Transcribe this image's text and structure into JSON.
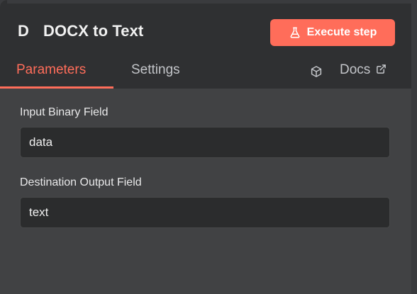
{
  "node": {
    "icon_letter": "D",
    "title": "DOCX to Text"
  },
  "execute_button": {
    "label": "Execute step",
    "icon": "flask-icon",
    "color": "#ff6d5a"
  },
  "tabs": [
    {
      "label": "Parameters",
      "active": true
    },
    {
      "label": "Settings",
      "active": false
    }
  ],
  "docs": {
    "label": "Docs",
    "icon": "box-icon",
    "link_icon": "external-link-icon"
  },
  "fields": [
    {
      "label": "Input Binary Field",
      "value": "data"
    },
    {
      "label": "Destination Output Field",
      "value": "text"
    }
  ],
  "colors": {
    "accent": "#ff6d5a",
    "header_bg": "#2f3032",
    "panel_bg": "#414244",
    "input_bg": "#2b2c2d"
  }
}
